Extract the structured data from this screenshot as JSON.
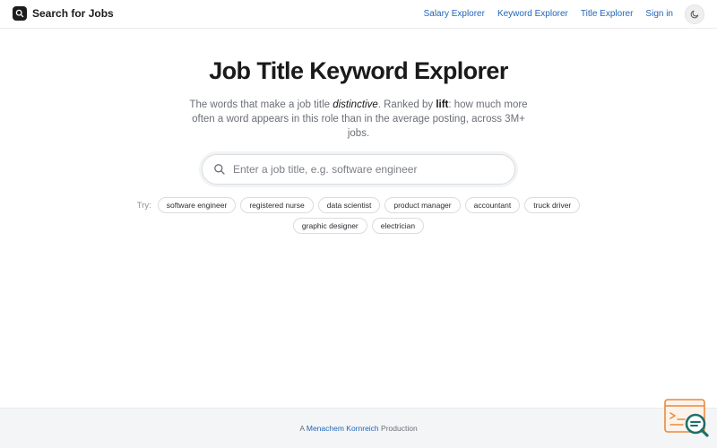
{
  "header": {
    "brand_name": "Search for Jobs",
    "brand_icon": "search-icon",
    "nav": [
      {
        "label": "Salary Explorer"
      },
      {
        "label": "Keyword Explorer"
      },
      {
        "label": "Title Explorer"
      },
      {
        "label": "Sign in"
      }
    ],
    "theme_toggle_icon": "moon-icon"
  },
  "hero": {
    "title": "Job Title Keyword Explorer",
    "subtitle_part1": "The words that make a job title ",
    "subtitle_em": "distinctive",
    "subtitle_part2": ". Ranked by ",
    "subtitle_strong": "lift",
    "subtitle_part3": ": how much more often a word appears in this role than in the average posting, across 3M+ jobs."
  },
  "search": {
    "placeholder": "Enter a job title, e.g. software engineer",
    "value": ""
  },
  "suggestions": {
    "label": "Try:",
    "row1": [
      "software engineer",
      "registered nurse",
      "data scientist",
      "product manager",
      "accountant",
      "truck driver"
    ],
    "row2": [
      "graphic designer",
      "electrician"
    ]
  },
  "footer": {
    "prefix": "A ",
    "author": "Menachem Kornreich",
    "suffix": " Production"
  },
  "colors": {
    "link": "#2266b8",
    "accent_orange": "#e98a3c",
    "accent_teal": "#1f6f6a"
  }
}
